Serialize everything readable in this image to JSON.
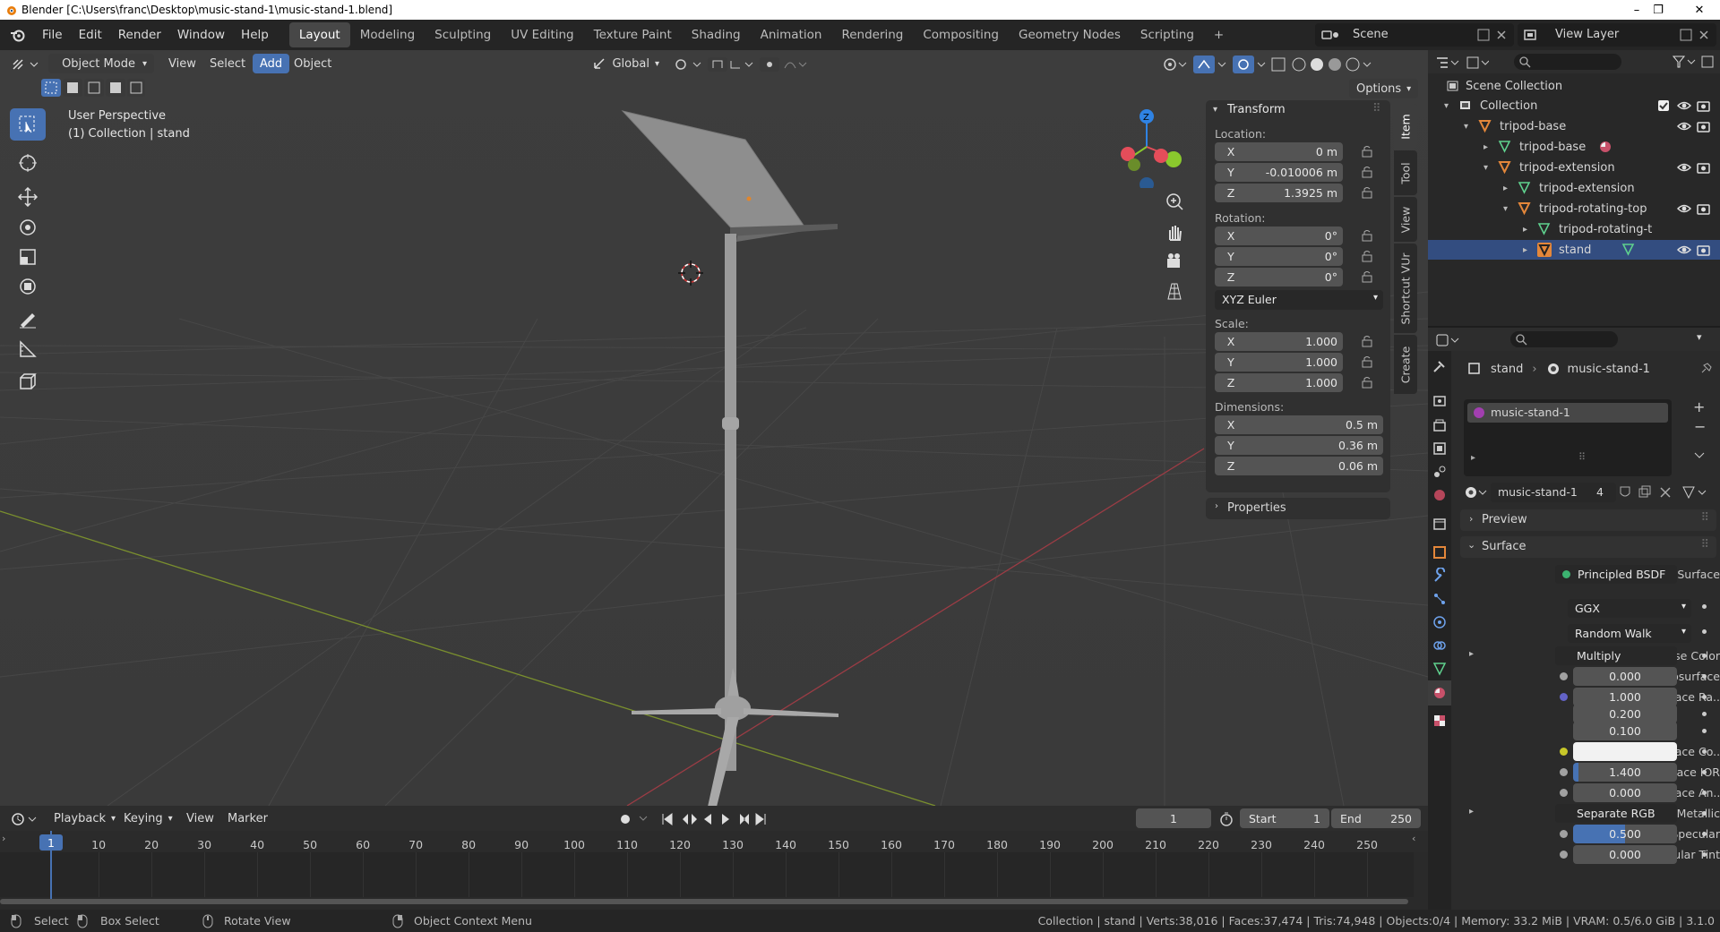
{
  "window": {
    "title": "Blender [C:\\Users\\franc\\Desktop\\music-stand-1\\music-stand-1.blend]",
    "minimize": "–",
    "maximize": "❐",
    "close": "✕"
  },
  "menus": [
    "File",
    "Edit",
    "Render",
    "Window",
    "Help"
  ],
  "workspaces": [
    "Layout",
    "Modeling",
    "Sculpting",
    "UV Editing",
    "Texture Paint",
    "Shading",
    "Animation",
    "Rendering",
    "Compositing",
    "Geometry Nodes",
    "Scripting"
  ],
  "add_workspace": "+",
  "scene": {
    "label": "Scene",
    "view_layer": "View Layer"
  },
  "viewport_header": {
    "mode": "Object Mode",
    "menus": [
      "View",
      "Select",
      "Add",
      "Object"
    ],
    "orientation": "Global",
    "options": "Options"
  },
  "viewport": {
    "perspective": "User Perspective",
    "collection": "(1) Collection | stand",
    "gizmo": {
      "z": "Z",
      "y": "Y",
      "x": "X"
    }
  },
  "npanel": {
    "transform_title": "Transform",
    "location_label": "Location:",
    "location": [
      {
        "axis": "X",
        "value": "0 m"
      },
      {
        "axis": "Y",
        "value": "-0.010006 m"
      },
      {
        "axis": "Z",
        "value": "1.3925 m"
      }
    ],
    "rotation_label": "Rotation:",
    "rotation": [
      {
        "axis": "X",
        "value": "0°"
      },
      {
        "axis": "Y",
        "value": "0°"
      },
      {
        "axis": "Z",
        "value": "0°"
      }
    ],
    "rotation_mode": "XYZ Euler",
    "scale_label": "Scale:",
    "scale": [
      {
        "axis": "X",
        "value": "1.000"
      },
      {
        "axis": "Y",
        "value": "1.000"
      },
      {
        "axis": "Z",
        "value": "1.000"
      }
    ],
    "dimensions_label": "Dimensions:",
    "dimensions": [
      {
        "axis": "X",
        "value": "0.5 m"
      },
      {
        "axis": "Y",
        "value": "0.36 m"
      },
      {
        "axis": "Z",
        "value": "0.06 m"
      }
    ],
    "properties_title": "Properties",
    "tabs": [
      "Item",
      "Tool",
      "View",
      "Shortcut VUr",
      "Create"
    ]
  },
  "outliner": {
    "root": "Scene Collection",
    "items": [
      {
        "label": "Collection",
        "indent": 0
      },
      {
        "label": "tripod-base",
        "indent": 1
      },
      {
        "label": "tripod-base",
        "indent": 2
      },
      {
        "label": "tripod-extension",
        "indent": 2
      },
      {
        "label": "tripod-extension",
        "indent": 3
      },
      {
        "label": "tripod-rotating-top",
        "indent": 3
      },
      {
        "label": "tripod-rotating-t",
        "indent": 4
      },
      {
        "label": "stand",
        "indent": 4
      }
    ]
  },
  "properties": {
    "breadcrumb_object": "stand",
    "breadcrumb_material": "music-stand-1",
    "slot": "music-stand-1",
    "material_name": "music-stand-1",
    "users": "4",
    "preview": "Preview",
    "surface_panel": "Surface",
    "surface_label": "Surface",
    "surface_value": "Principled BSDF",
    "distribution": "GGX",
    "subsurface_method": "Random Walk",
    "rows": [
      {
        "label": "Base Color",
        "value": "Multiply",
        "type": "link"
      },
      {
        "label": "Subsurface",
        "value": "0.000",
        "type": "num"
      },
      {
        "label": "Subsurface Ra...",
        "value": "1.000",
        "type": "num"
      },
      {
        "label": "",
        "value": "0.200",
        "type": "num"
      },
      {
        "label": "",
        "value": "0.100",
        "type": "num"
      },
      {
        "label": "Subsurface Co...",
        "value": "",
        "type": "color"
      },
      {
        "label": "Subsurface IOR",
        "value": "1.400",
        "type": "num"
      },
      {
        "label": "Subsurface An...",
        "value": "0.000",
        "type": "num"
      },
      {
        "label": "Metallic",
        "value": "Separate RGB",
        "type": "link"
      },
      {
        "label": "Specular",
        "value": "0.500",
        "type": "num"
      },
      {
        "label": "Specular Tint",
        "value": "0.000",
        "type": "num"
      }
    ]
  },
  "timeline": {
    "menus": [
      "Playback",
      "Keying",
      "View",
      "Marker"
    ],
    "current_frame": "1",
    "start_label": "Start",
    "start": "1",
    "end_label": "End",
    "end": "250",
    "ticks": [
      "1",
      "10",
      "20",
      "30",
      "40",
      "50",
      "60",
      "70",
      "80",
      "90",
      "100",
      "110",
      "120",
      "130",
      "140",
      "150",
      "160",
      "170",
      "180",
      "190",
      "200",
      "210",
      "220",
      "230",
      "240",
      "250"
    ]
  },
  "statusbar": {
    "select": "Select",
    "box_select": "Box Select",
    "rotate": "Rotate View",
    "context": "Object Context Menu",
    "stats": "Collection | stand | Verts:38,016 | Faces:37,474 | Tris:74,948 | Objects:0/4 | Memory: 33.2 MiB | VRAM: 0.5/6.0 GiB | 3.1.0"
  },
  "colors": {
    "accent": "#4772b3",
    "mesh_orange": "#e4873a",
    "mesh_green": "#5fd18e",
    "axis_x": "#e44d5a",
    "axis_y": "#8ac92d",
    "axis_z": "#2f83e4"
  }
}
